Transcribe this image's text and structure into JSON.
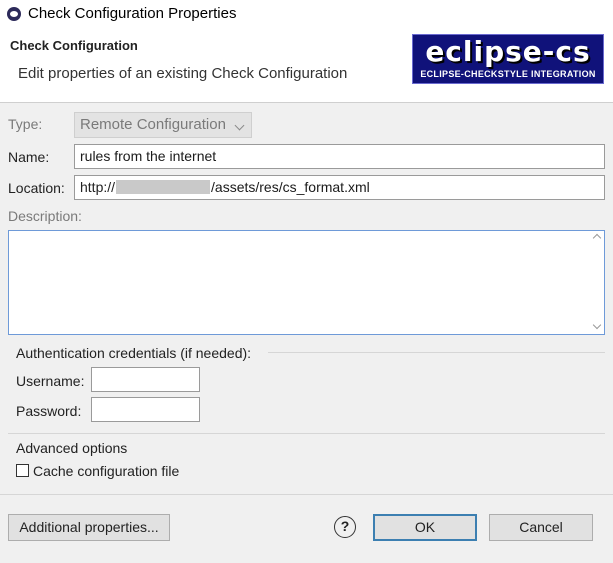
{
  "window": {
    "title": "Check Configuration Properties"
  },
  "header": {
    "title": "Check Configuration",
    "message": "Edit properties of an existing Check Configuration",
    "logo": {
      "main": "eclipse-cs",
      "sub": "ECLIPSE-CHECKSTYLE INTEGRATION"
    }
  },
  "form": {
    "type": {
      "label": "Type:",
      "value": "Remote Configuration"
    },
    "name": {
      "label": "Name:",
      "value": "rules from the internet"
    },
    "location": {
      "label": "Location:",
      "prefix": "http://",
      "suffix": "/assets/res/cs_format.xml"
    },
    "description": {
      "label": "Description:",
      "value": ""
    }
  },
  "auth": {
    "legend": "Authentication credentials (if needed):",
    "username": {
      "label": "Username:",
      "value": ""
    },
    "password": {
      "label": "Password:",
      "value": ""
    }
  },
  "advanced": {
    "legend": "Advanced options",
    "cache": {
      "label": "Cache configuration file",
      "checked": false
    }
  },
  "buttons": {
    "additional": "Additional properties...",
    "help": "?",
    "ok": "OK",
    "cancel": "Cancel"
  },
  "icons": [
    "app-icon",
    "help-icon",
    "chevron-down-icon"
  ]
}
